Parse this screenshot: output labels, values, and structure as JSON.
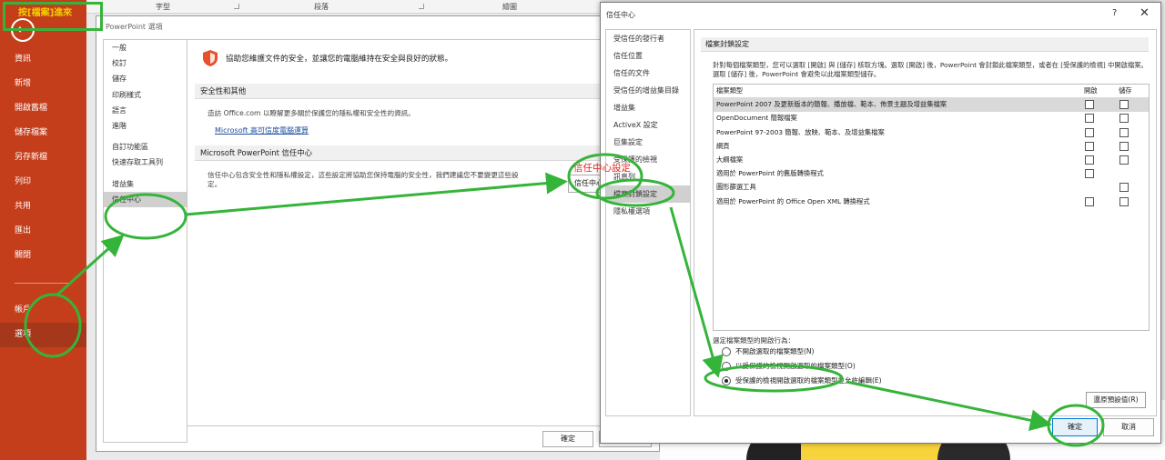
{
  "annotation": {
    "callout": "按[檔案]進來",
    "trust_center_label": "信任中心設定"
  },
  "backstage": {
    "items": [
      "資訊",
      "新增",
      "開啟舊檔",
      "儲存檔案",
      "另存新檔",
      "列印",
      "共用",
      "匯出",
      "關閉"
    ],
    "bottom_items": [
      "帳戶",
      "選項"
    ]
  },
  "ribbon": {
    "groups": [
      "字型",
      "段落",
      "繪圖"
    ]
  },
  "options": {
    "title": "PowerPoint 選項",
    "nav": [
      "一般",
      "校訂",
      "儲存",
      "印刷樣式",
      "語言",
      "進階",
      "自訂功能區",
      "快速存取工具列",
      "增益集",
      "信任中心"
    ],
    "headline": "協助您維護文件的安全，並讓您的電腦維持在安全與良好的狀態。",
    "privacy_header": "安全性和其他",
    "privacy_text": "造訪 Office.com 以瞭解更多關於保護您的隱私權和安全性的資訊。",
    "privacy_link": "Microsoft 高可信度電腦運算",
    "tc_header": "Microsoft PowerPoint 信任中心",
    "tc_text_line1": "信任中心包含安全性和隱私權設定，這些設定將協助您保持電腦的安全性，我們建議您不要變更這些設",
    "tc_text_line2": "定。",
    "tc_button": "信任中心設定(T)...",
    "ok": "確定",
    "cancel": "取消"
  },
  "trust": {
    "title": "信任中心",
    "help": "?",
    "close": "✕",
    "nav": [
      "受信任的發行者",
      "信任位置",
      "信任的文件",
      "受信任的增益集目錄",
      "增益集",
      "ActiveX 設定",
      "巨集設定",
      "受保護的檢視",
      "訊息列",
      "檔案封鎖設定",
      "隱私權選項"
    ],
    "panel_header": "檔案封鎖設定",
    "desc": "針對每個檔案類型，您可以選取 [開啟] 與 [儲存] 核取方塊。選取 [開啟] 後，PowerPoint 會封鎖此檔案類型，或者在 [受保護的檢視] 中開啟檔案。選取 [儲存] 後，PowerPoint 會避免以此檔案類型儲存。",
    "col_type": "檔案類型",
    "col_open": "開啟",
    "col_save": "儲存",
    "rows": [
      "PowerPoint 2007 及更新版本的簡報、播放檔、範本、佈景主題及增益集檔案",
      "OpenDocument 簡報檔案",
      "PowerPoint 97-2003 簡報、放映、範本、及增益集檔案",
      "網頁",
      "大綱檔案",
      "適用於 PowerPoint 的舊版轉換程式",
      "圖形篩選工具",
      "適用於 PowerPoint 的 Office Open XML 轉換程式"
    ],
    "behavior_label": "選定檔案類型的開啟行為：",
    "options": [
      "不開啟選取的檔案類型(N)",
      "以受保護的檢視開啟選取的檔案類型(O)",
      "受保護的檢視開啟選取的檔案類型並允許編輯(E)"
    ],
    "selected_option": 2,
    "restore": "還原預設值(R)",
    "ok": "確定",
    "cancel": "取消"
  },
  "colors": {
    "backstage": "#c43e1c",
    "annotation": "#35b43a",
    "label_red": "#e0241c",
    "label_yellow": "#f0d000"
  }
}
